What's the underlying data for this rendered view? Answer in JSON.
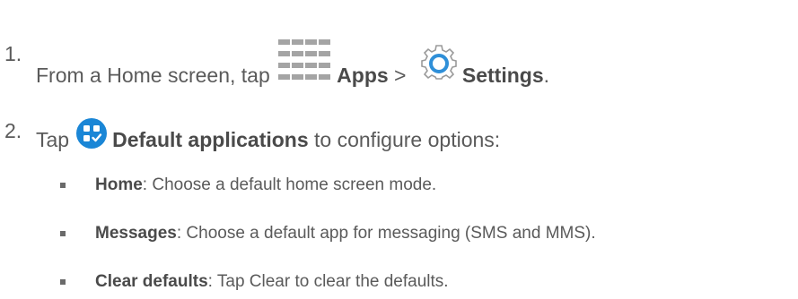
{
  "steps": [
    {
      "number": "1.",
      "text_before": "From a Home screen, tap",
      "apps_label": "Apps",
      "separator": " > ",
      "settings_label": "Settings",
      "end": "."
    },
    {
      "number": "2.",
      "text_before": "Tap",
      "defaults_label": "Default applications",
      "text_after": " to configure options:"
    }
  ],
  "options": [
    {
      "term": "Home",
      "description": ": Choose a default home screen mode."
    },
    {
      "term": "Messages",
      "description": ": Choose a default app for messaging (SMS and MMS)."
    },
    {
      "term": "Clear defaults",
      "description": ": Tap Clear to clear the defaults."
    }
  ],
  "icons": {
    "apps": "apps-grid-icon",
    "settings": "settings-gear-icon",
    "default_applications": "default-applications-icon"
  },
  "colors": {
    "text": "#5a5a5a",
    "icon_gray": "#a4a4a4",
    "settings_blue": "#2f8fd8",
    "defaults_blue": "#1a86d6"
  }
}
